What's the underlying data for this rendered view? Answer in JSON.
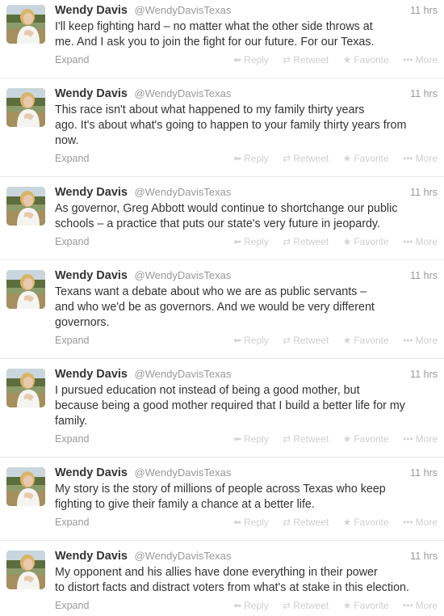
{
  "actions": {
    "expand": "Expand",
    "reply": "Reply",
    "retweet": "Retweet",
    "favorite": "Favorite",
    "more": "More"
  },
  "icons": {
    "reply": "reply-arrow-icon",
    "retweet": "retweet-icon",
    "favorite": "star-icon",
    "more": "ellipsis-icon"
  },
  "colors": {
    "name": "#333333",
    "meta": "#999999",
    "action": "#cfcfcf",
    "divider": "#e8e8e8"
  },
  "tweets": [
    {
      "fullname": "Wendy Davis",
      "username": "@WendyDavisTexas",
      "time": "11 hrs",
      "text": "I'll keep fighting hard – no matter what the other side throws at\nme. And I ask you to join the fight for our future. For our Texas."
    },
    {
      "fullname": "Wendy Davis",
      "username": "@WendyDavisTexas",
      "time": "11 hrs",
      "text": "This race isn't about what happened to my family thirty years\nago. It's about what's going to happen to your family thirty years from\nnow."
    },
    {
      "fullname": "Wendy Davis",
      "username": "@WendyDavisTexas",
      "time": "11 hrs",
      "text": "As governor, Greg Abbott would continue to shortchange our public\nschools – a practice that puts our state's very future in jeopardy."
    },
    {
      "fullname": "Wendy Davis",
      "username": "@WendyDavisTexas",
      "time": "11 hrs",
      "text": "Texans want a debate about who we are as public servants –\nand who we'd be as governors. And we would be very different\ngovernors."
    },
    {
      "fullname": "Wendy Davis",
      "username": "@WendyDavisTexas",
      "time": "11 hrs",
      "text": "I pursued education not instead of being a good mother, but\nbecause being a good mother required that I build a better life for my\nfamily."
    },
    {
      "fullname": "Wendy Davis",
      "username": "@WendyDavisTexas",
      "time": "11 hrs",
      "text": "My story is the story of millions of people across Texas who keep\nfighting to give their family a chance at a better life."
    },
    {
      "fullname": "Wendy Davis",
      "username": "@WendyDavisTexas",
      "time": "11 hrs",
      "text": "My opponent and his allies have done everything in their power\nto distort facts and distract voters from what's at stake in this election."
    }
  ]
}
